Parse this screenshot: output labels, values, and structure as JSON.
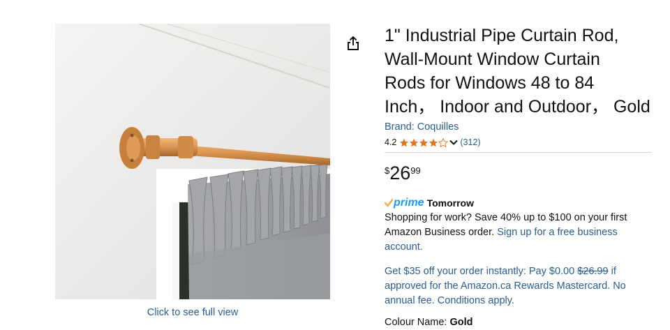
{
  "product": {
    "title_lines": [
      "1\" Industrial Pipe Curtain Rod,",
      "Wall-Mount Window Curtain",
      "Rods for Windows 48 to 84",
      "Inch， Indoor and Outdoor， Gold"
    ],
    "brand": "Brand: Coquilles",
    "rating": {
      "value": "4.2",
      "stars": 4.2,
      "count": "(312)"
    },
    "price": {
      "symbol": "$",
      "whole": "26",
      "fraction": "99"
    }
  },
  "image": {
    "caption": "Click to see full view"
  },
  "delivery": {
    "prime_label": "prime",
    "when": "Tomorrow"
  },
  "business_offer": {
    "text": "Shopping for work? Save 40% up to $100 on your first Amazon Business order. ",
    "link": "Sign up for a free business account."
  },
  "card_offer": {
    "before": "Get $35 off your order instantly: Pay $0.00 ",
    "strike": "$26.99",
    "after": " if approved for the Amazon.ca Rewards Mastercard. No annual fee. Conditions apply."
  },
  "colour": {
    "label": "Colour Name: ",
    "value": "Gold"
  },
  "colors": {
    "link": "#2a5d8f",
    "star": "#de7921",
    "prime_blue": "#1a98ff",
    "prime_check": "#f3a847"
  },
  "icons": {
    "share": "share-icon",
    "star": "star-icon",
    "chevron": "chevron-down-icon",
    "prime": "prime-check-icon"
  }
}
